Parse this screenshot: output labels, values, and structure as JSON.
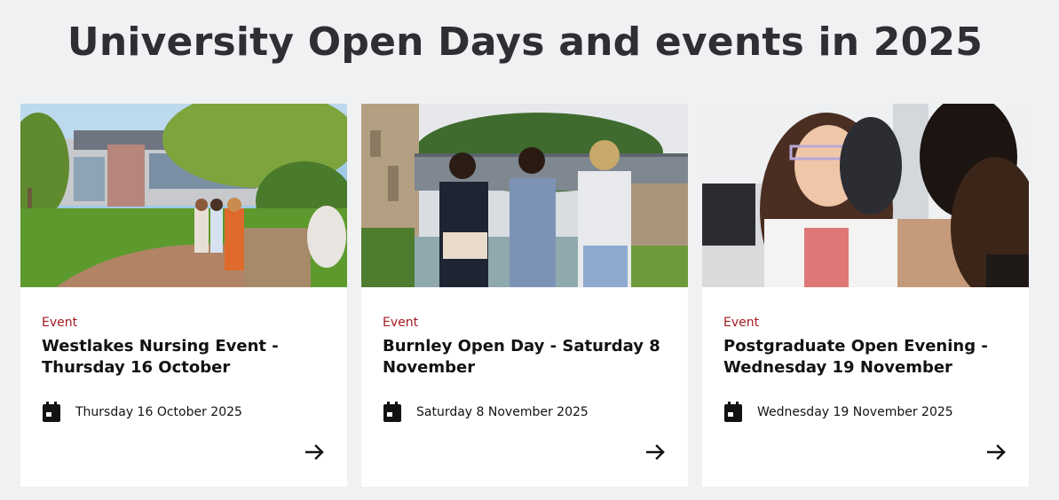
{
  "page": {
    "title": "University Open Days and events in 2025"
  },
  "cards": [
    {
      "tag": "Event",
      "title": "Westlakes Nursing Event - Thursday 16 October",
      "date": "Thursday 16 October 2025",
      "image": "campus-building-students-on-bench",
      "icons": {
        "date": "calendar-icon",
        "action": "arrow-right-icon"
      }
    },
    {
      "tag": "Event",
      "title": "Burnley Open Day - Saturday 8 November",
      "date": "Saturday 8 November 2025",
      "image": "students-walking-by-canal",
      "icons": {
        "date": "calendar-icon",
        "action": "arrow-right-icon"
      }
    },
    {
      "tag": "Event",
      "title": "Postgraduate Open Evening - Wednesday 19 November",
      "date": "Wednesday 19 November 2025",
      "image": "smiling-students-in-classroom",
      "icons": {
        "date": "calendar-icon",
        "action": "arrow-right-icon"
      }
    }
  ],
  "colors": {
    "background": "#f0f1f2",
    "tag": "#a31b20",
    "title": "#2d2f33",
    "card": "#ffffff"
  }
}
